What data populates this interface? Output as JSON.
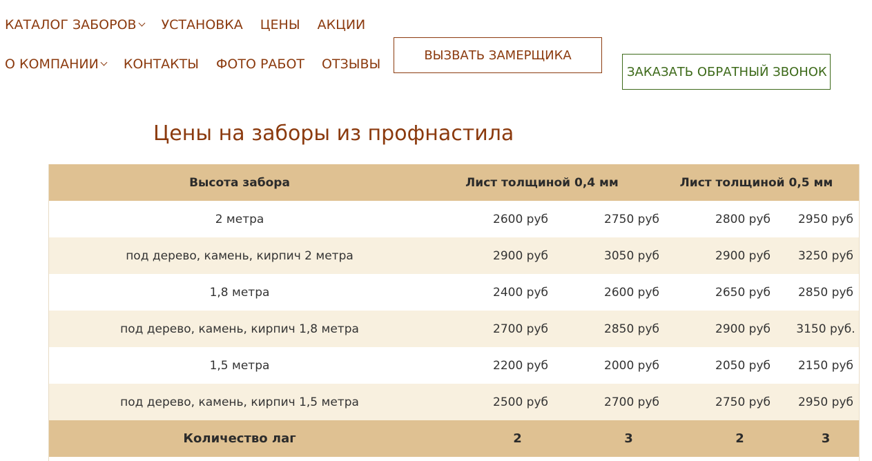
{
  "nav": {
    "row1": [
      {
        "label": "КАТАЛОГ ЗАБОРОВ",
        "has_dropdown": true
      },
      {
        "label": "УСТАНОВКА",
        "has_dropdown": false
      },
      {
        "label": "ЦЕНЫ",
        "has_dropdown": false
      },
      {
        "label": "АКЦИИ",
        "has_dropdown": false
      }
    ],
    "row2": [
      {
        "label": "О КОМПАНИИ",
        "has_dropdown": true
      },
      {
        "label": "КОНТАКТЫ",
        "has_dropdown": false
      },
      {
        "label": "ФОТО РАБОТ",
        "has_dropdown": false
      },
      {
        "label": "ОТЗЫВЫ",
        "has_dropdown": false
      }
    ]
  },
  "buttons": {
    "call_measurer": "ВЫЗВАТЬ ЗАМЕРЩИКА",
    "order_callback": "ЗАКАЗАТЬ ОБРАТНЫЙ ЗВОНОК"
  },
  "page": {
    "title": "Цены на заборы из профнастила"
  },
  "price_table": {
    "headers": {
      "height": "Высота забора",
      "sheet_04": "Лист толщиной 0,4 мм",
      "sheet_05": "Лист толщиной 0,5 мм"
    },
    "rows": [
      {
        "label": "2 метра",
        "values": [
          "2600 руб",
          "2750 руб",
          "2800 руб",
          "2950 руб"
        ]
      },
      {
        "label": "под дерево, камень, кирпич 2 метра",
        "values": [
          "2900 руб",
          "3050 руб",
          "2900 руб",
          "3250 руб"
        ]
      },
      {
        "label": "1,8 метра",
        "values": [
          "2400 руб",
          "2600 руб",
          "2650 руб",
          "2850 руб"
        ]
      },
      {
        "label": "под дерево, камень, кирпич 1,8 метра",
        "values": [
          "2700 руб",
          "2850 руб",
          "2900 руб",
          "3150 руб."
        ]
      },
      {
        "label": "1,5 метра",
        "values": [
          "2200 руб",
          "2000 руб",
          "2050 руб",
          "2150 руб"
        ]
      },
      {
        "label": "под дерево, камень, кирпич 1,5 метра",
        "values": [
          "2500 руб",
          "2700 руб",
          "2750 руб",
          "2950 руб"
        ]
      }
    ],
    "footer": {
      "label": "Количество лаг",
      "values": [
        "2",
        "3",
        "2",
        "3"
      ]
    }
  },
  "colors": {
    "nav_text": "#8b3a0e",
    "callback_button": "#3d6a1a",
    "table_header_bg": "#dfc192",
    "table_alt_row_bg": "#f8f0df"
  },
  "icons": {
    "dropdown": "chevron-down-icon"
  }
}
